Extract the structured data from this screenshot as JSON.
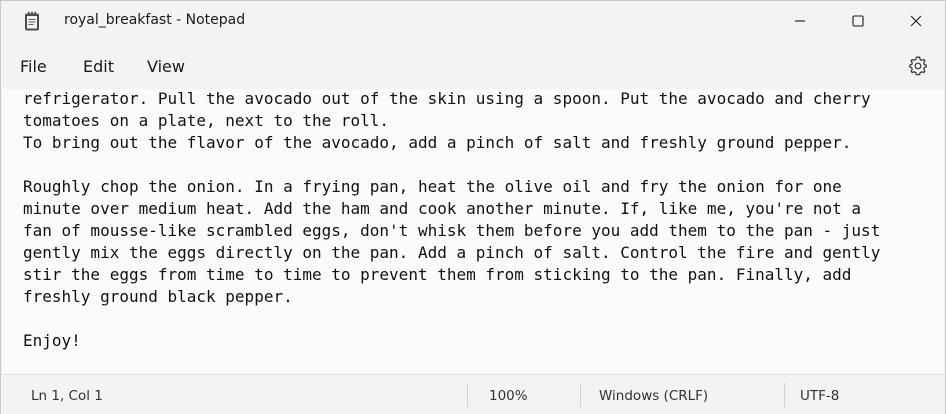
{
  "window": {
    "title": "royal_breakfast - Notepad",
    "app_icon": "notepad-icon",
    "caption_icons": [
      "minimize-icon",
      "maximize-icon",
      "close-icon"
    ]
  },
  "menu": {
    "file": "File",
    "edit": "Edit",
    "view": "View",
    "settings_icon": "gear-icon"
  },
  "editor": {
    "lines": [
      "refrigerator. Pull the avocado out of the skin using a spoon. Put the avocado and cherry",
      "tomatoes on a plate, next to the roll.",
      "To bring out the flavor of the avocado, add a pinch of salt and freshly ground pepper.",
      "",
      "Roughly chop the onion. In a frying pan, heat the olive oil and fry the onion for one",
      "minute over medium heat. Add the ham and cook another minute. If, like me, you're not a",
      "fan of mousse-like scrambled eggs, don't whisk them before you add them to the pan - just",
      "gently mix the eggs directly on the pan. Add a pinch of salt. Control the fire and gently",
      "stir the eggs from time to time to prevent them from sticking to the pan. Finally, add",
      "freshly ground black pepper.",
      "",
      "Enjoy!"
    ]
  },
  "status": {
    "position": "Ln 1, Col 1",
    "zoom": "100%",
    "line_ending": "Windows (CRLF)",
    "encoding": "UTF-8"
  }
}
